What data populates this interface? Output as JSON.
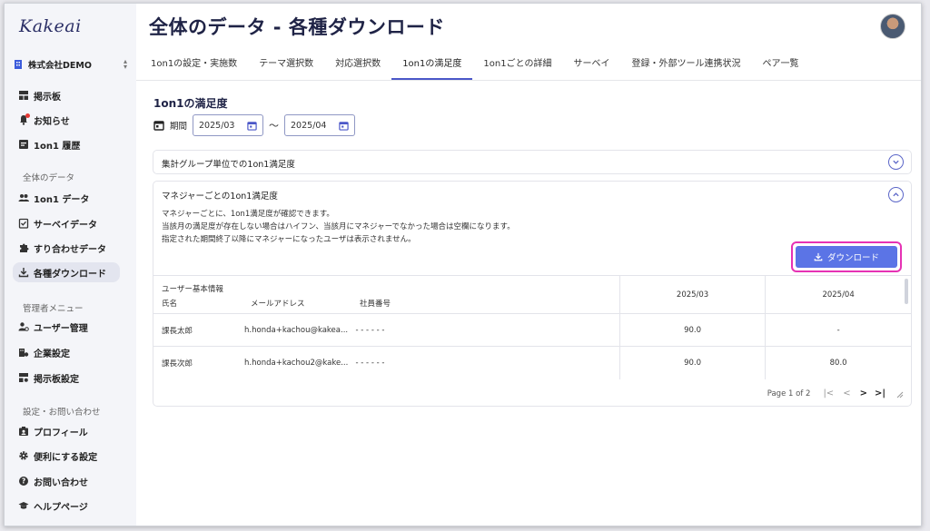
{
  "app": {
    "logo": "Kakeai"
  },
  "sidebar": {
    "company": "株式会社DEMO",
    "items_top": [
      {
        "label": "掲示板",
        "icon": "board-icon"
      },
      {
        "label": "お知らせ",
        "icon": "bell-icon"
      },
      {
        "label": "1on1 履歴",
        "icon": "history-icon"
      }
    ],
    "section_data": "全体のデータ",
    "items_data": [
      {
        "label": "1on1 データ",
        "icon": "users-icon"
      },
      {
        "label": "サーベイデータ",
        "icon": "survey-icon"
      },
      {
        "label": "すり合わせデータ",
        "icon": "puzzle-icon"
      },
      {
        "label": "各種ダウンロード",
        "icon": "download-icon",
        "active": true
      }
    ],
    "section_admin": "管理者メニュー",
    "items_admin": [
      {
        "label": "ユーザー管理",
        "icon": "user-manage-icon"
      },
      {
        "label": "企業設定",
        "icon": "company-icon"
      },
      {
        "label": "掲示板設定",
        "icon": "board-settings-icon"
      }
    ],
    "section_settings": "設定・お問い合わせ",
    "items_settings": [
      {
        "label": "プロフィール",
        "icon": "profile-icon"
      },
      {
        "label": "便利にする設定",
        "icon": "gear-icon"
      },
      {
        "label": "お問い合わせ",
        "icon": "help-icon"
      },
      {
        "label": "ヘルプページ",
        "icon": "graduation-icon"
      }
    ]
  },
  "header": {
    "title": "全体のデータ - 各種ダウンロード"
  },
  "tabs": [
    "1on1の設定・実施数",
    "テーマ選択数",
    "対応選択数",
    "1on1の満足度",
    "1on1ごとの詳細",
    "サーベイ",
    "登録・外部ツール連携状況",
    "ペア一覧"
  ],
  "active_tab": 3,
  "main": {
    "section_title": "1on1の満足度",
    "period_label": "期間",
    "date_from": "2025/03",
    "date_to": "2025/04",
    "tilde": "〜",
    "card1_title": "集計グループ単位での1on1満足度",
    "card2_title": "マネジャーごとの1on1満足度",
    "card2_desc": [
      "マネジャーごとに、1on1満足度が確認できます。",
      "当該月の満足度が存在しない場合はハイフン、当該月にマネジャーでなかった場合は空欄になります。",
      "指定された期間終了以降にマネジャーになったユーザは表示されません。"
    ],
    "download_label": "ダウンロード"
  },
  "table": {
    "group_header": "ユーザー基本情報",
    "columns": [
      "氏名",
      "メールアドレス",
      "社員番号",
      "2025/03",
      "2025/04"
    ],
    "rows": [
      [
        "課長太郎",
        "h.honda+kachou@kakea...",
        "- - - - - -",
        "90.0",
        "-"
      ],
      [
        "課長次郎",
        "h.honda+kachou2@kake...",
        "- - - - - -",
        "90.0",
        "80.0"
      ]
    ]
  },
  "pager": {
    "text": "Page 1 of 2",
    "first": "|<",
    "prev": "<",
    "next": ">",
    "last": ">|"
  },
  "colors": {
    "accent": "#4b57c8",
    "button": "#5b74e6",
    "highlight": "#e632b4"
  }
}
